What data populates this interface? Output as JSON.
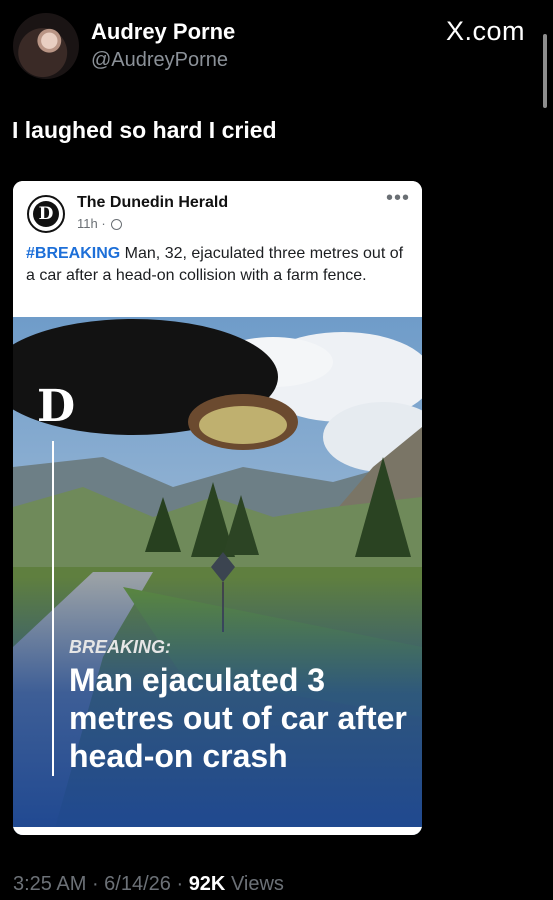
{
  "author": {
    "name": "Audrey Porne",
    "handle": "@AudreyPorne"
  },
  "site_logo": "X.com",
  "tweet": {
    "text": "I laughed so hard I cried"
  },
  "embedded_post": {
    "page_name": "The Dunedin Herald",
    "logo_letter": "D",
    "time": "11h ·",
    "more_icon": "more-horizontal-icon",
    "hashtag": "#BREAKING",
    "caption": " Man, 32, ejaculated three metres out of a car after a head-on collision with a farm fence.",
    "image": {
      "logo_letter": "D",
      "label": "BREAKING:",
      "headline": "Man ejaculated 3 metres out of car after head-on crash"
    }
  },
  "meta": {
    "time": "3:25 AM",
    "sep1": " · ",
    "date": "6/14/26",
    "sep2": " · ",
    "views_count": "92K",
    "views_label": " Views"
  },
  "colors": {
    "background": "#000000",
    "hashtag": "#1d6fd8",
    "image_bottom": "#1f4891"
  }
}
